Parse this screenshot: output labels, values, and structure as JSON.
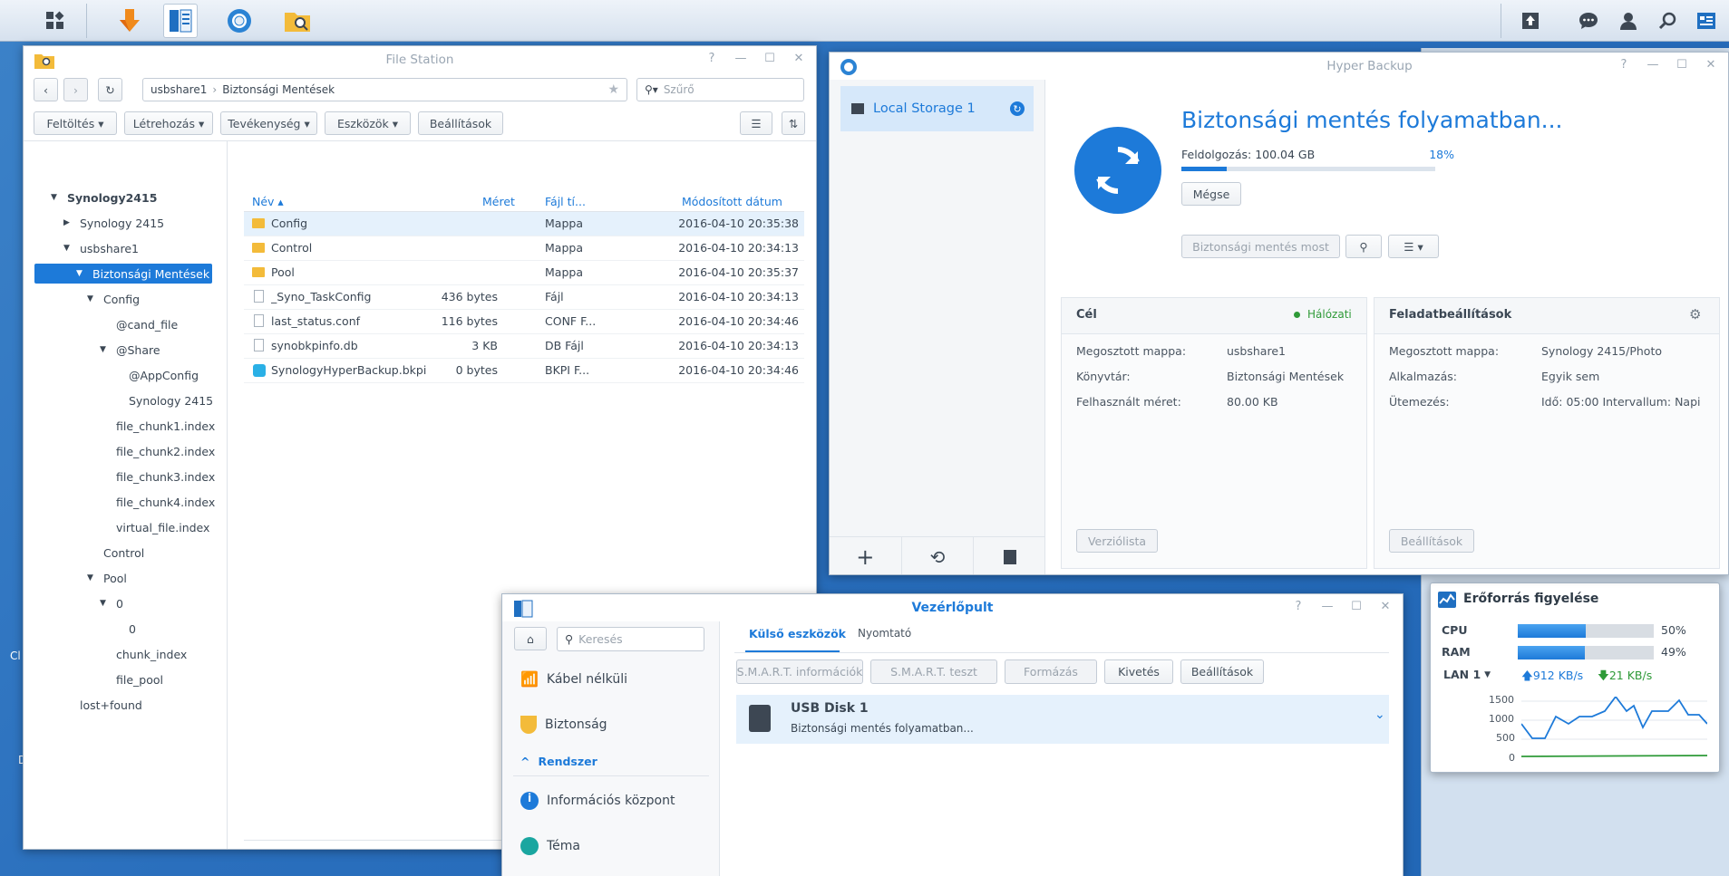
{
  "taskbar": {
    "left_icons": [
      "apps-grid-icon",
      "download-station-icon",
      "control-panel-icon",
      "hyper-backup-icon",
      "file-station-icon"
    ],
    "right_icons": [
      "upload-icon",
      "chat-icon",
      "user-icon",
      "search-icon",
      "widgets-icon"
    ]
  },
  "file_station": {
    "title": "File Station",
    "path": [
      "usbshare1",
      "Biztonsági Mentések"
    ],
    "filter_placeholder": "Szűrő",
    "toolbar": [
      "Feltöltés",
      "Létrehozás",
      "Tevékenység",
      "Eszközök",
      "Beállítások"
    ],
    "tree": [
      {
        "label": "Synology2415",
        "bold": true,
        "expander": "down",
        "indent": 0
      },
      {
        "label": "Synology 2415",
        "expander": "right",
        "indent": 1
      },
      {
        "label": "usbshare1",
        "expander": "down",
        "indent": 1
      },
      {
        "label": "Biztonsági Mentések",
        "expander": "down",
        "indent": 2,
        "selected": true
      },
      {
        "label": "Config",
        "expander": "down",
        "indent": 3
      },
      {
        "label": "@cand_file",
        "expander": "",
        "indent": 4
      },
      {
        "label": "@Share",
        "expander": "down",
        "indent": 4
      },
      {
        "label": "@AppConfig",
        "expander": "",
        "indent": 5
      },
      {
        "label": "Synology 2415",
        "expander": "",
        "indent": 5
      },
      {
        "label": "file_chunk1.index",
        "expander": "",
        "indent": 4
      },
      {
        "label": "file_chunk2.index",
        "expander": "",
        "indent": 4
      },
      {
        "label": "file_chunk3.index",
        "expander": "",
        "indent": 4
      },
      {
        "label": "file_chunk4.index",
        "expander": "",
        "indent": 4
      },
      {
        "label": "virtual_file.index",
        "expander": "",
        "indent": 4
      },
      {
        "label": "Control",
        "expander": "",
        "indent": 3
      },
      {
        "label": "Pool",
        "expander": "down",
        "indent": 3
      },
      {
        "label": "0",
        "expander": "down",
        "indent": 4
      },
      {
        "label": "0",
        "expander": "",
        "indent": 5
      },
      {
        "label": "chunk_index",
        "expander": "",
        "indent": 4
      },
      {
        "label": "file_pool",
        "expander": "",
        "indent": 4
      },
      {
        "label": "lost+found",
        "expander": "",
        "indent": 1
      }
    ],
    "columns": {
      "name": "Név",
      "size": "Méret",
      "type": "Fájl tí...",
      "modified": "Módosított dátum"
    },
    "files": [
      {
        "name": "Config",
        "size": "",
        "type": "Mappa",
        "modified": "2016-04-10 20:35:38",
        "kind": "folder"
      },
      {
        "name": "Control",
        "size": "",
        "type": "Mappa",
        "modified": "2016-04-10 20:34:13",
        "kind": "folder"
      },
      {
        "name": "Pool",
        "size": "",
        "type": "Mappa",
        "modified": "2016-04-10 20:35:37",
        "kind": "folder"
      },
      {
        "name": "_Syno_TaskConfig",
        "size": "436 bytes",
        "type": "Fájl",
        "modified": "2016-04-10 20:34:13",
        "kind": "file"
      },
      {
        "name": "last_status.conf",
        "size": "116 bytes",
        "type": "CONF F...",
        "modified": "2016-04-10 20:34:46",
        "kind": "file"
      },
      {
        "name": "synobkpinfo.db",
        "size": "3 KB",
        "type": "DB Fájl",
        "modified": "2016-04-10 20:34:13",
        "kind": "file"
      },
      {
        "name": "SynologyHyperBackup.bkpi",
        "size": "0 bytes",
        "type": "BKPI F...",
        "modified": "2016-04-10 20:34:46",
        "kind": "bkpi"
      }
    ]
  },
  "hyper_backup": {
    "title": "Hyper Backup",
    "storage": "Local Storage 1",
    "status_title": "Biztonsági mentés folyamatban...",
    "progress_label": "Feldolgozás: 100.04 GB",
    "progress_percent": "18%",
    "progress_value": 0.18,
    "cancel": "Mégse",
    "backup_now": "Biztonsági mentés most",
    "target": {
      "title": "Cél",
      "status": "Hálózati",
      "rows": [
        {
          "k": "Megosztott mappa:",
          "v": "usbshare1"
        },
        {
          "k": "Könyvtár:",
          "v": "Biztonsági Mentések"
        },
        {
          "k": "Felhasznált méret:",
          "v": "80.00 KB"
        }
      ],
      "button": "Verziólista"
    },
    "task": {
      "title": "Feladatbeállítások",
      "rows": [
        {
          "k": "Megosztott mappa:",
          "v": "Synology 2415/Photo"
        },
        {
          "k": "Alkalmazás:",
          "v": "Egyik sem"
        },
        {
          "k": "Ütemezés:",
          "v": "Idő: 05:00 Intervallum: Napi"
        }
      ],
      "button": "Beállítások"
    }
  },
  "control_panel": {
    "title": "Vezérlőpult",
    "search_placeholder": "Keresés",
    "menu": {
      "wireless": "Kábel nélküli",
      "security": "Biztonság",
      "section": "Rendszer",
      "info": "Információs központ",
      "theme": "Téma"
    },
    "tabs": [
      "Külső eszközök",
      "Nyomtató"
    ],
    "actions": [
      {
        "label": "S.M.A.R.T. információk",
        "disabled": true
      },
      {
        "label": "S.M.A.R.T. teszt",
        "disabled": true
      },
      {
        "label": "Formázás",
        "disabled": true
      },
      {
        "label": "Kivetés",
        "disabled": false
      },
      {
        "label": "Beállítások",
        "disabled": false
      }
    ],
    "device": {
      "name": "USB Disk 1",
      "status": "Biztonsági mentés folyamatban..."
    }
  },
  "resource_monitor": {
    "title": "Erőforrás figyelése",
    "cpu_label": "CPU",
    "cpu": "50%",
    "cpu_value": 0.5,
    "ram_label": "RAM",
    "ram": "49%",
    "ram_value": 0.49,
    "lan": "LAN 1",
    "upload": "912 KB/s",
    "download": "21 KB/s",
    "y_ticks": [
      "1500",
      "1000",
      "500",
      "0"
    ]
  },
  "desktop": {
    "edge_labels": [
      "Cl",
      "D"
    ]
  }
}
